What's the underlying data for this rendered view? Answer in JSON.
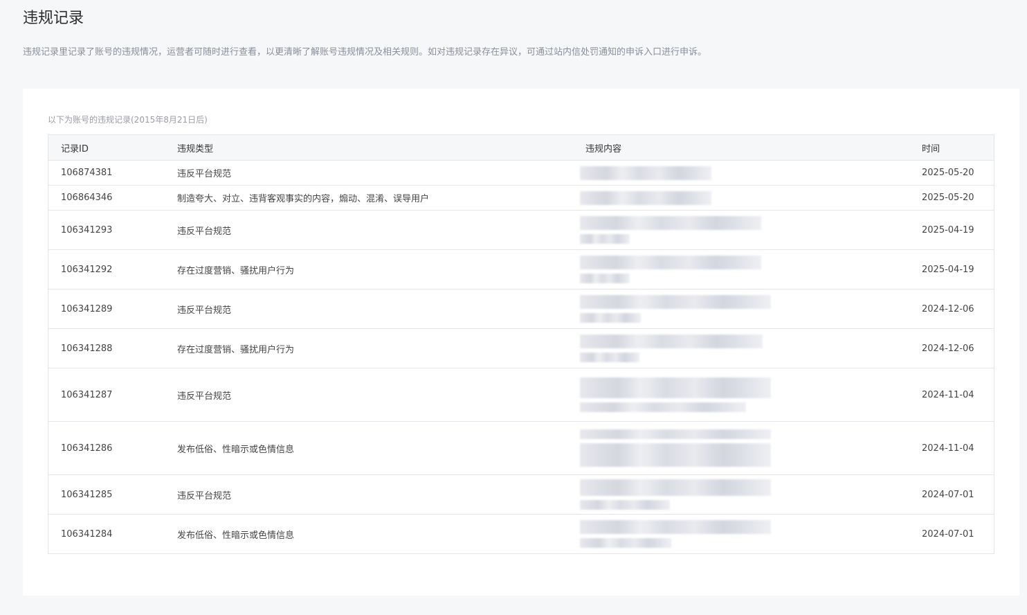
{
  "page": {
    "title": "违规记录",
    "description": "违规记录里记录了账号的违规情况，运营者可随时进行查看，以更清晰了解账号违规情况及相关规则。如对违规记录存在异议，可通过站内信处罚通知的申诉入口进行申诉。"
  },
  "table": {
    "caption": "以下为账号的违规记录(2015年8月21日后)",
    "headers": {
      "id": "记录ID",
      "type": "违规类型",
      "content": "违规内容",
      "time": "时间"
    },
    "rows": [
      {
        "id": "106874381",
        "type": "违反平台规范",
        "time": "2025-05-20"
      },
      {
        "id": "106864346",
        "type": "制造夸大、对立、违背客观事实的内容，煽动、混淆、误导用户",
        "time": "2025-05-20"
      },
      {
        "id": "106341293",
        "type": "违反平台规范",
        "time": "2025-04-19"
      },
      {
        "id": "106341292",
        "type": "存在过度营销、骚扰用户行为",
        "time": "2025-04-19"
      },
      {
        "id": "106341289",
        "type": "违反平台规范",
        "time": "2024-12-06"
      },
      {
        "id": "106341288",
        "type": "存在过度营销、骚扰用户行为",
        "time": "2024-12-06"
      },
      {
        "id": "106341287",
        "type": "违反平台规范",
        "time": "2024-11-04"
      },
      {
        "id": "106341286",
        "type": "发布低俗、性暗示或色情信息",
        "time": "2024-11-04"
      },
      {
        "id": "106341285",
        "type": "违反平台规范",
        "time": "2024-07-01"
      },
      {
        "id": "106341284",
        "type": "发布低俗、性暗示或色情信息",
        "time": "2024-07-01"
      }
    ]
  }
}
